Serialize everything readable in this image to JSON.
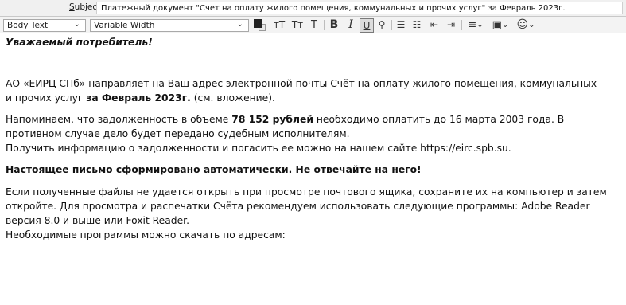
{
  "subject": {
    "label_u": "S",
    "label_rest": "ubject",
    "value": "Платежный документ \"Счет на оплату жилого помещения, коммунальных и прочих услуг\" за Февраль 2023г."
  },
  "toolbar": {
    "paragraph_format": "Body Text",
    "font": "Variable Width",
    "text_color": "#222222",
    "increase_size_icon": "тТ",
    "decrease_size_icon": "Тт",
    "size_icon": "Т",
    "bold": "B",
    "italic": "I",
    "underline": "U",
    "insert_icon": "⚲",
    "bullet_icon": "☰",
    "numbered_icon": "☷",
    "outdent_icon": "⇤",
    "indent_icon": "⇥",
    "align_icon": "≡",
    "insert_menu_icon": "▣",
    "emoji_icon": "☺",
    "chevron": "⌄"
  },
  "message": {
    "greeting": "Уважаемый потребитель!",
    "p1_a": "АО «ЕИРЦ СПб» направляет на Ваш адрес электронной почты Счёт на оплату жилого помещения, коммунальных",
    "p1_b": "и прочих услуг ",
    "p1_bold": "за Февраль 2023г.",
    "p1_c": " (см. вложение).",
    "p2_a": "Напоминаем, что задолженность в объеме ",
    "p2_bold": "78 152 рублей",
    "p2_b": " необходимо оплатить до 16 марта 2003 года. В",
    "p2_line2": "противном случае дело будет передано судебным исполнителям.",
    "p2_line3": "Получить информацию о задолженности и погасить ее можно на нашем сайте https://eirc.spb.su.",
    "p3": "Настоящее письмо сформировано автоматически. Не отвечайте на него!",
    "p4_line1": "Если полученные файлы не удается открыть при просмотре почтового ящика, сохраните их на компьютер и затем",
    "p4_line2": "откройте. Для просмотра и распечатки Счёта рекомендуем использовать следующие программы: Adobe Reader",
    "p4_line3": "версия 8.0 и выше или Foxit Reader.",
    "p4_line4": "Необходимые программы можно скачать по адресам:"
  }
}
